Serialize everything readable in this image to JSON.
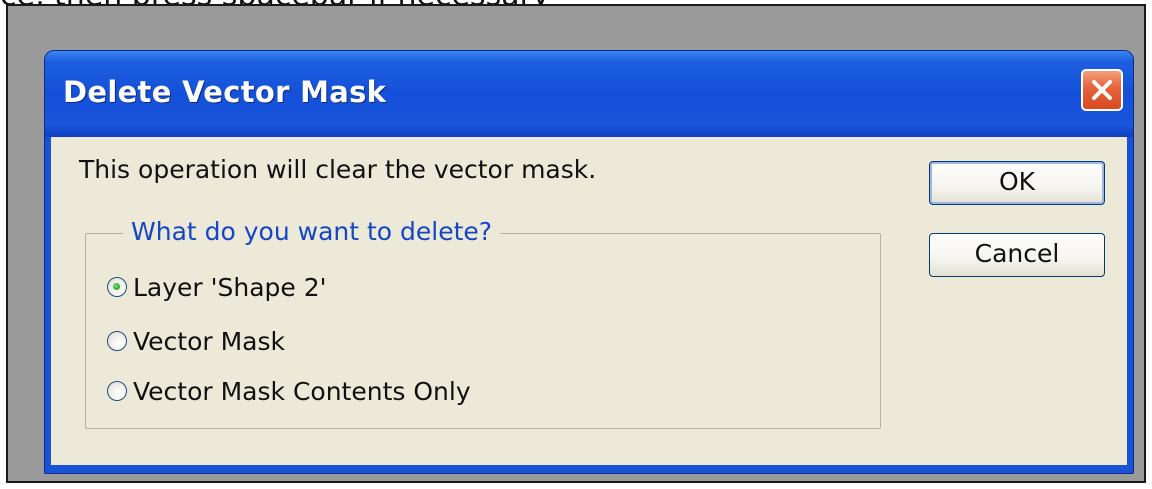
{
  "top_caption": "ce, then press spacebar if necessary",
  "dialog": {
    "title": "Delete Vector Mask",
    "close_icon": "close-x-icon",
    "message": "This operation will clear the vector mask.",
    "group_label": "What do you want to delete?",
    "options": [
      {
        "label": "Layer 'Shape 2'",
        "selected": true
      },
      {
        "label": "Vector Mask",
        "selected": false
      },
      {
        "label": "Vector Mask Contents Only",
        "selected": false
      }
    ],
    "ok_label": "OK",
    "cancel_label": "Cancel"
  },
  "colors": {
    "titlebar": "#1450d8",
    "client_bg": "#ece9d8",
    "group_label": "#1546c6",
    "close_button": "#e5623a"
  }
}
